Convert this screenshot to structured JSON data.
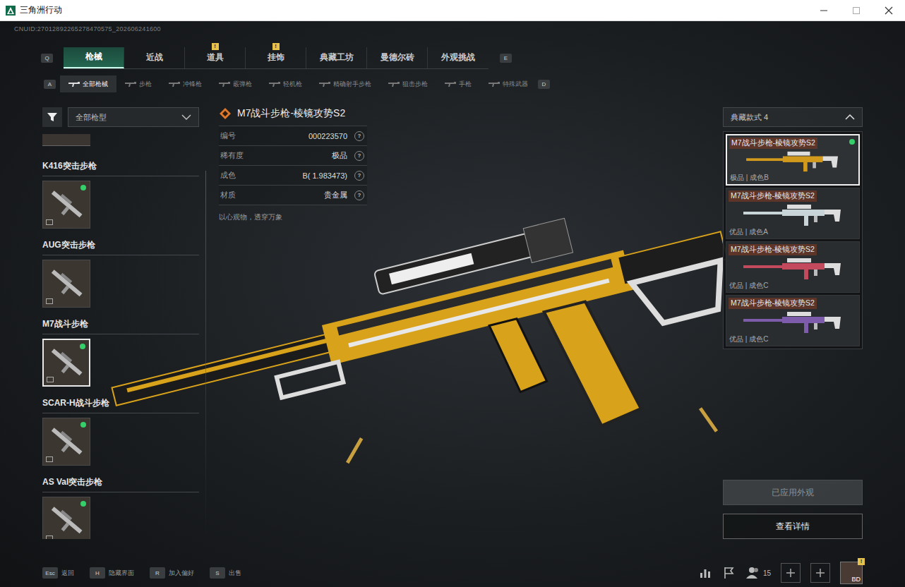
{
  "window": {
    "title": "三角洲行动"
  },
  "uid": "CNUID:27012892265278470575_202606241600",
  "tab_keys": {
    "prev": "Q",
    "next": "E"
  },
  "main_tabs": [
    {
      "label": "枪械",
      "selected": true,
      "badge": ""
    },
    {
      "label": "近战",
      "selected": false,
      "badge": ""
    },
    {
      "label": "道具",
      "selected": false,
      "badge": "!"
    },
    {
      "label": "挂饰",
      "selected": false,
      "badge": "!"
    },
    {
      "label": "典藏工坊",
      "selected": false,
      "badge": ""
    },
    {
      "label": "曼德尔砖",
      "selected": false,
      "badge": ""
    },
    {
      "label": "外观挑战",
      "selected": false,
      "badge": ""
    }
  ],
  "sub_tab_keys": {
    "prev": "A",
    "next": "D"
  },
  "sub_tabs": [
    {
      "label": "全部枪械",
      "selected": true
    },
    {
      "label": "步枪",
      "selected": false
    },
    {
      "label": "冲锋枪",
      "selected": false
    },
    {
      "label": "霰弹枪",
      "selected": false
    },
    {
      "label": "轻机枪",
      "selected": false
    },
    {
      "label": "精确射手步枪",
      "selected": false
    },
    {
      "label": "狙击步枪",
      "selected": false
    },
    {
      "label": "手枪",
      "selected": false
    },
    {
      "label": "特殊武器",
      "selected": false
    }
  ],
  "filter": {
    "value": "全部枪型"
  },
  "weapons": [
    {
      "name": "K416突击步枪",
      "selected": false,
      "equipped": true
    },
    {
      "name": "AUG突击步枪",
      "selected": false,
      "equipped": false
    },
    {
      "name": "M7战斗步枪",
      "selected": true,
      "equipped": true
    },
    {
      "name": "SCAR-H战斗步枪",
      "selected": false,
      "equipped": true
    },
    {
      "name": "AS Val突击步枪",
      "selected": false,
      "equipped": true
    }
  ],
  "detail": {
    "title": "M7战斗步枪-棱镜攻势S2",
    "rows": [
      {
        "label": "编号",
        "value": "000223570",
        "help": "?"
      },
      {
        "label": "稀有度",
        "value": "极品",
        "help": "?"
      },
      {
        "label": "成色",
        "value": "B( 1.983473)",
        "help": "?"
      },
      {
        "label": "材质",
        "value": "贵金属",
        "help": "?"
      }
    ],
    "description": "以心观物，透穿万象"
  },
  "style_select": {
    "label": "典藏款式 4",
    "expanded": true
  },
  "variants": [
    {
      "name": "M7战斗步枪-棱镜攻势S2",
      "caption": "极品 | 成色B",
      "selected": true,
      "equipped": true,
      "color": "#d29a1c"
    },
    {
      "name": "M7战斗步枪-棱镜攻势S2",
      "caption": "优品 | 成色A",
      "selected": false,
      "equipped": false,
      "color": "#c9d4d8"
    },
    {
      "name": "M7战斗步枪-棱镜攻势S2",
      "caption": "优品 | 成色C",
      "selected": false,
      "equipped": false,
      "color": "#c24a5c"
    },
    {
      "name": "M7战斗步枪-棱镜攻势S2",
      "caption": "优品 | 成色C",
      "selected": false,
      "equipped": false,
      "color": "#7d5cab"
    }
  ],
  "buttons": [
    {
      "label": "已应用外观",
      "disabled": true
    },
    {
      "label": "查看详情",
      "disabled": false
    }
  ],
  "hotkeys": [
    {
      "key": "Esc",
      "label": "返回"
    },
    {
      "key": "H",
      "label": "隐藏界面"
    },
    {
      "key": "R",
      "label": "加入偏好"
    },
    {
      "key": "S",
      "label": "出售"
    }
  ],
  "status": {
    "friends": "15",
    "avatar": "BD",
    "badge": "!"
  }
}
